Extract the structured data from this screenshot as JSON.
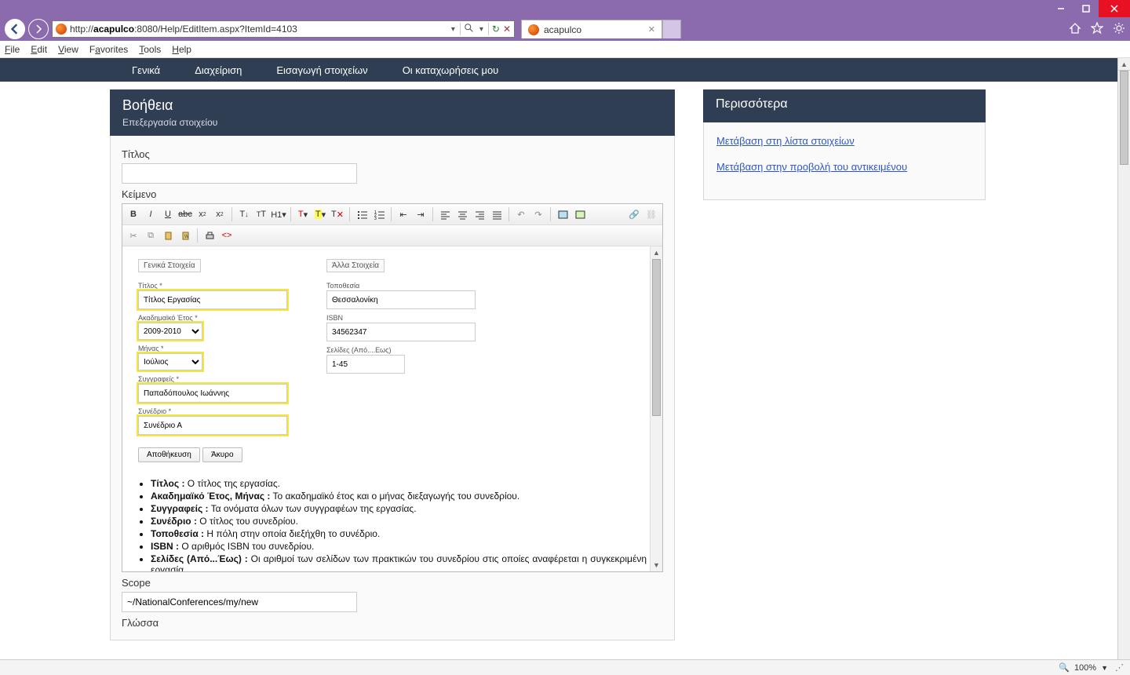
{
  "window": {
    "min": "—",
    "max": "▢",
    "close": "✕"
  },
  "address": {
    "url_prefix": "http://",
    "url_host": "acapulco",
    "url_rest": ":8080/Help/EditItem.aspx?ItemId=4103"
  },
  "tab": {
    "title": "acapulco"
  },
  "menubar": {
    "file": "File",
    "edit": "Edit",
    "view": "View",
    "favorites": "Favorites",
    "tools": "Tools",
    "help": "Help"
  },
  "topnav": {
    "a": "Γενικά",
    "b": "Διαχείριση",
    "c": "Εισαγωγή στοιχείων",
    "d": "Οι καταχωρήσεις μου"
  },
  "help": {
    "title": "Βοήθεια",
    "subtitle": "Επεξεργασία στοιχείου"
  },
  "form": {
    "title_lbl": "Τίτλος",
    "text_lbl": "Κείμενο",
    "scope_lbl": "Scope",
    "scope_val": "~/NationalConferences/my/new",
    "lang_lbl": "Γλώσσα"
  },
  "inner": {
    "general_legend": "Γενικά Στοιχεία",
    "other_legend": "Άλλα Στοιχεία",
    "title_lbl": "Τίτλος *",
    "title_val": "Τίτλος Εργασίας",
    "year_lbl": "Ακαδημαϊκό Έτος *",
    "year_val": "2009-2010",
    "month_lbl": "Μήνας *",
    "month_val": "Ιούλιος",
    "authors_lbl": "Συγγραφείς *",
    "authors_val": "Παπαδόπουλος Ιωάννης",
    "conf_lbl": "Συνέδριο *",
    "conf_val": "Συνέδριο Α",
    "location_lbl": "Τοποθεσία",
    "location_val": "Θεσσαλονίκη",
    "isbn_lbl": "ISBN",
    "isbn_val": "34562347",
    "pages_lbl": "Σελίδες (Από....Εως)",
    "pages_val": "1-45",
    "save_btn": "Αποθήκευση",
    "cancel_btn": "Άκυρο"
  },
  "desc": {
    "d1b": "Τίτλος :",
    "d1t": " Ο τίτλος της εργασίας.",
    "d2b": "Ακαδημαϊκό Έτος, Μήνας :",
    "d2t": " Το ακαδημαϊκό έτος και ο μήνας διεξαγωγής του συνεδρίου.",
    "d3b": "Συγγραφείς :",
    "d3t": " Τα ονόματα όλων των συγγραφέων της εργασίας.",
    "d4b": "Συνέδριο :",
    "d4t": " Ο τίτλος του συνεδρίου.",
    "d5b": "Τοποθεσία :",
    "d5t": " Η πόλη στην οποία διεξήχθη το συνέδριο.",
    "d6b": "ISBN :",
    "d6t": " Ο αριθμός ISBN του συνεδρίου.",
    "d7b": "Σελίδες (Από...Έως) :",
    "d7t": " Οι αριθμοί των σελίδων των πρακτικών του συνεδρίου στις οποίες αναφέρεται η συγκεκριμένη εργασία."
  },
  "right": {
    "title": "Περισσότερα",
    "link1": "Μετάβαση στη λίστα στοιχείων",
    "link2": "Μετάβαση στην προβολή του αντικειμένου"
  },
  "status": {
    "zoom": "100%"
  }
}
